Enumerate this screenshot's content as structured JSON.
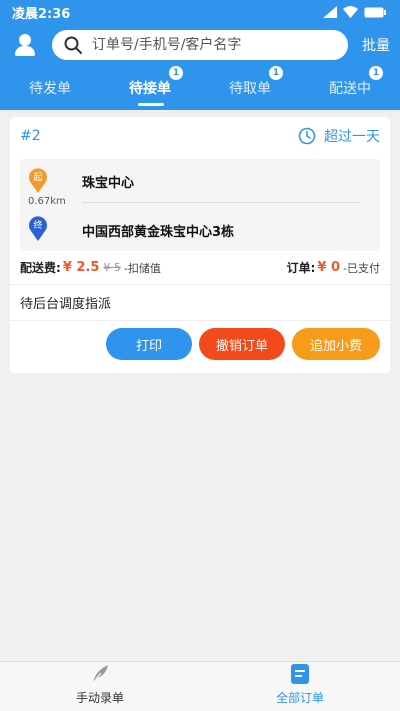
{
  "status_bar": {
    "time": "凌晨2:36"
  },
  "search": {
    "placeholder": "订单号/手机号/客户名字"
  },
  "header": {
    "batch_label": "批量"
  },
  "tabs": [
    {
      "label": "待发单",
      "badge": ""
    },
    {
      "label": "待接单",
      "badge": "1"
    },
    {
      "label": "待取单",
      "badge": "1"
    },
    {
      "label": "配送中",
      "badge": "1"
    }
  ],
  "order": {
    "number": "#2",
    "overdue_label": "超过一天",
    "start_marker": "起",
    "end_marker": "终",
    "pickup": "珠宝中心",
    "distance": "0.67km",
    "dropoff": "中国西部黄金珠宝中心3栋",
    "fee_label": "配送费:",
    "fee_price": "¥ 2.5",
    "fee_original": "¥ 5",
    "fee_note": "-扣储值",
    "order_label": "订单:",
    "order_price": "¥ 0",
    "order_note": "-已支付",
    "dispatch_status": "待后台调度指派",
    "buttons": {
      "print": "打印",
      "cancel": "撤销订单",
      "add_tip": "追加小费"
    }
  },
  "bottom_nav": [
    {
      "label": "手动录单",
      "icon": "feather-icon"
    },
    {
      "label": "全部订单",
      "icon": "document-icon"
    }
  ],
  "colors": {
    "primary": "#2f95ec",
    "cancel": "#f24a1a",
    "tip": "#f69b1a",
    "price": "#f05a28",
    "start_pin": "#f39a2b",
    "end_pin": "#2a62d6"
  }
}
